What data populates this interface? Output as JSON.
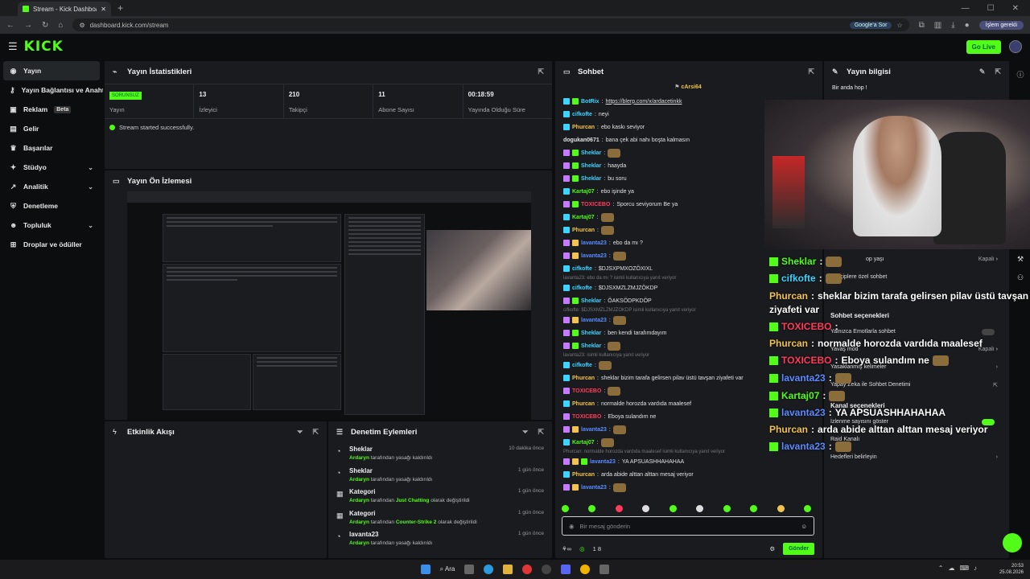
{
  "browser": {
    "tab_title": "Stream - Kick Dashboard",
    "url": "dashboard.kick.com/stream",
    "google_btn": "Google'a Sor",
    "profile_btn": "İşlem gerekli"
  },
  "topbar": {
    "logo": "KICK",
    "go_live": "Go Live"
  },
  "sidebar": {
    "items": [
      {
        "label": "Yayın",
        "icon": "broadcast-icon"
      },
      {
        "label": "Yayın Bağlantısı ve Anahtarı",
        "icon": "key-icon"
      },
      {
        "label": "Reklam",
        "icon": "ad-icon",
        "badge": "Beta"
      },
      {
        "label": "Gelir",
        "icon": "money-icon"
      },
      {
        "label": "Başarılar",
        "icon": "trophy-icon"
      },
      {
        "label": "Stüdyo",
        "icon": "studio-icon"
      },
      {
        "label": "Analitik",
        "icon": "chart-icon"
      },
      {
        "label": "Denetleme",
        "icon": "shield-icon"
      },
      {
        "label": "Topluluk",
        "icon": "people-icon"
      },
      {
        "label": "Droplar ve ödüller",
        "icon": "gift-icon"
      }
    ]
  },
  "stats_panel": {
    "title": "Yayın İstatistikleri",
    "stats": [
      {
        "value": "SORUNSUZ",
        "label": "Yayın"
      },
      {
        "value": "13",
        "label": "İzleyici"
      },
      {
        "value": "210",
        "label": "Takipçi"
      },
      {
        "value": "11",
        "label": "Abone Sayısı"
      },
      {
        "value": "00:18:59",
        "label": "Yayında Olduğu Süre"
      }
    ],
    "success_msg": "Stream started successfully."
  },
  "preview_panel": {
    "title": "Yayın Ön İzlemesi"
  },
  "activity_panel": {
    "title": "Etkinlik Akışı"
  },
  "mod_panel": {
    "title": "Denetim Eylemleri",
    "rows": [
      {
        "icon": "clock-icon",
        "name": "Sheklar",
        "actor": "Ardaryn",
        "action": "tarafından yasağı kaldırıldı",
        "time": "10 dakika önce"
      },
      {
        "icon": "clock-icon",
        "name": "Sheklar",
        "actor": "Ardaryn",
        "action": "tarafından yasağı kaldırıldı",
        "time": "1 gün önce"
      },
      {
        "icon": "category-icon",
        "name": "Kategori",
        "actor": "Ardaryn",
        "action_pre": "tarafından",
        "highlight": "Just Chatting",
        "action": "olarak değiştirildi",
        "time": "1 gün önce"
      },
      {
        "icon": "category-icon",
        "name": "Kategori",
        "actor": "Ardaryn",
        "action_pre": "tarafından",
        "highlight": "Counter-Strike 2",
        "action": "olarak değiştirildi",
        "time": "1 gün önce"
      },
      {
        "icon": "clock-icon",
        "name": "lavanta23",
        "actor": "Ardaryn",
        "action": "tarafından yasağı kaldırıldı",
        "time": "1 gün önce"
      }
    ]
  },
  "chat": {
    "title": "Sohbet",
    "pinned": "cArsi64",
    "messages": [
      {
        "u": "BotRix",
        "c": "#3fd3ff",
        "t": "https://blerp.com/x/ardacetinkk",
        "b": [
          "c",
          "g"
        ]
      },
      {
        "u": "cifkofte",
        "c": "#3fd3ff",
        "t": "neyi",
        "b": [
          "c"
        ]
      },
      {
        "u": "Phurcan",
        "c": "#f2c34d",
        "t": "ebo kaskı seviyor",
        "b": [
          "c"
        ]
      },
      {
        "u": "dogukan0671",
        "c": "#e0e0e0",
        "t": "bana çek abi nahı boşta kalmasın",
        "b": []
      },
      {
        "u": "Sheklar",
        "c": "#3fd3ff",
        "t": "",
        "b": [
          "p",
          "g"
        ],
        "emo": true
      },
      {
        "u": "Sheklar",
        "c": "#3fd3ff",
        "t": "haayda",
        "b": [
          "p",
          "g"
        ]
      },
      {
        "u": "Sheklar",
        "c": "#3fd3ff",
        "t": "bu soru",
        "b": [
          "p",
          "g"
        ]
      },
      {
        "u": "Kartaj07",
        "c": "#53fc18",
        "t": "ebo işinde ya",
        "b": [
          "c"
        ]
      },
      {
        "u": "TOXICEBO",
        "c": "#ff3b5c",
        "t": "Sporcu seviyorum Be ya",
        "b": [
          "p",
          "g"
        ]
      },
      {
        "u": "Kartaj07",
        "c": "#53fc18",
        "t": "",
        "b": [
          "c"
        ],
        "emo": true
      },
      {
        "u": "Phurcan",
        "c": "#f2c34d",
        "t": "",
        "b": [
          "c"
        ],
        "emo": true
      },
      {
        "u": "lavanta23",
        "c": "#5a8bff",
        "t": "ebo da mı ?",
        "b": [
          "p",
          "y"
        ]
      },
      {
        "u": "lavanta23",
        "c": "#5a8bff",
        "t": "",
        "b": [
          "p",
          "y"
        ],
        "emo": true
      },
      {
        "u": "cifkofte",
        "c": "#3fd3ff",
        "t": "$DJSXPMXOZÖXIXL",
        "b": [
          "c"
        ]
      },
      {
        "sys": "lavanta23: ebo da mı ? isimli kullanıcıya yanıt veriyor"
      },
      {
        "u": "cifkofte",
        "c": "#3fd3ff",
        "t": "$DJSXMZLZMJZÖKDP",
        "b": [
          "c"
        ]
      },
      {
        "u": "Sheklar",
        "c": "#3fd3ff",
        "t": "ÖAKSÖDPKDÖP",
        "b": [
          "p",
          "g"
        ]
      },
      {
        "sys": "cifkofte: $DJSXMZLZMJZÖKDP isimli kullanıcıya yanıt veriyor"
      },
      {
        "u": "lavanta23",
        "c": "#5a8bff",
        "t": "",
        "b": [
          "p",
          "y"
        ],
        "emo": true
      },
      {
        "u": "Sheklar",
        "c": "#3fd3ff",
        "t": "ben kendi tarafımdayım",
        "b": [
          "p",
          "g"
        ]
      },
      {
        "u": "Sheklar",
        "c": "#3fd3ff",
        "t": "",
        "b": [
          "p",
          "g"
        ],
        "emo": true
      },
      {
        "sys": "lavanta23: isimli kullanıcıya yanıt veriyor"
      },
      {
        "u": "cifkofte",
        "c": "#3fd3ff",
        "t": "",
        "b": [
          "c"
        ],
        "emo": true
      },
      {
        "u": "Phurcan",
        "c": "#f2c34d",
        "t": "sheklar bizim tarafa gelirsen pilav üstü tavşan ziyafeti var",
        "b": [
          "c"
        ]
      },
      {
        "u": "TOXICEBO",
        "c": "#ff3b5c",
        "t": "",
        "b": [
          "p"
        ],
        "emo": true
      },
      {
        "u": "Phurcan",
        "c": "#f2c34d",
        "t": "normalde horozda vardıda maalesef",
        "b": [
          "c"
        ]
      },
      {
        "u": "TOXICEBO",
        "c": "#ff3b5c",
        "t": "Eboya sulandım ne",
        "b": [
          "p"
        ]
      },
      {
        "u": "lavanta23",
        "c": "#5a8bff",
        "t": "",
        "b": [
          "p",
          "y"
        ],
        "emo": true
      },
      {
        "u": "Kartaj07",
        "c": "#53fc18",
        "t": "",
        "b": [
          "c"
        ],
        "emo": true
      },
      {
        "sys": "Phurcan: normalde horozda vardıda maalesef isimli kullanıcıya yanıt veriyor"
      },
      {
        "u": "lavanta23",
        "c": "#5a8bff",
        "t": "YA APSUASHHAHAHAA",
        "b": [
          "p",
          "y",
          "g"
        ]
      },
      {
        "u": "Phurcan",
        "c": "#f2c34d",
        "t": "arda abide alttan alttan mesaj veriyor",
        "b": [
          "c"
        ]
      },
      {
        "u": "lavanta23",
        "c": "#5a8bff",
        "t": "",
        "b": [
          "p",
          "y"
        ],
        "emo": true
      }
    ],
    "input_placeholder": "Bir mesaj gönderin",
    "points": "1 8",
    "send": "Gönder"
  },
  "info_panel": {
    "title": "Yayın bilgisi",
    "welcome": "Bir anda hop !"
  },
  "overlay_chat": [
    {
      "u": "Sheklar",
      "c": "#53fc18",
      "t": "",
      "emo": true
    },
    {
      "u": "cifkofte",
      "c": "#3fd3ff",
      "t": "",
      "emo": true
    },
    {
      "u": "Phurcan",
      "c": "#f2c34d",
      "t": "sheklar bizim tarafa gelirsen pilav üstü tavşan"
    },
    {
      "u": "",
      "c": "#ffffff",
      "t": "ziyafeti var"
    },
    {
      "u": "TOXICEBO",
      "c": "#ff3b5c",
      "t": ""
    },
    {
      "u": "Phurcan",
      "c": "#f2c34d",
      "t": "normalde horozda vardıda maalesef"
    },
    {
      "u": "TOXICEBO",
      "c": "#ff3b5c",
      "t": "Eboya sulandım ne",
      "emo": true
    },
    {
      "u": "lavanta23",
      "c": "#5a8bff",
      "t": "",
      "emo": true
    },
    {
      "u": "Kartaj07",
      "c": "#53fc18",
      "t": "",
      "emo": true
    },
    {
      "u": "lavanta23",
      "c": "#5a8bff",
      "t": "YA APSUASHHAHAHAA"
    },
    {
      "u": "Phurcan",
      "c": "#f2c34d",
      "t": "arda abide alttan alttan mesaj veriyor"
    },
    {
      "u": "lavanta23",
      "c": "#5a8bff",
      "t": "",
      "emo": true
    }
  ],
  "chat_settings": {
    "opt1": "op yaşı",
    "opt1_val": "Kapalı",
    "opt2": "çiplere özel sohbet",
    "head1": "Sohbet seçenekleri",
    "opt3": "Yalnızca Emotlarla sohbet",
    "opt4": "Yavaş mod",
    "opt4_val": "Kapalı",
    "opt5": "Yasaklanmış kelimeler",
    "opt6": "Yapay Zeka ile Sohbet Denetimi",
    "head2": "Kanal seçenekleri",
    "opt7": "İzlenme sayısını göster",
    "opt8": "Raid Kanalı",
    "opt9": "Hedefleri belirleyin"
  },
  "taskbar": {
    "search": "Ara",
    "time": "20:53",
    "date": "25.08.2026"
  }
}
